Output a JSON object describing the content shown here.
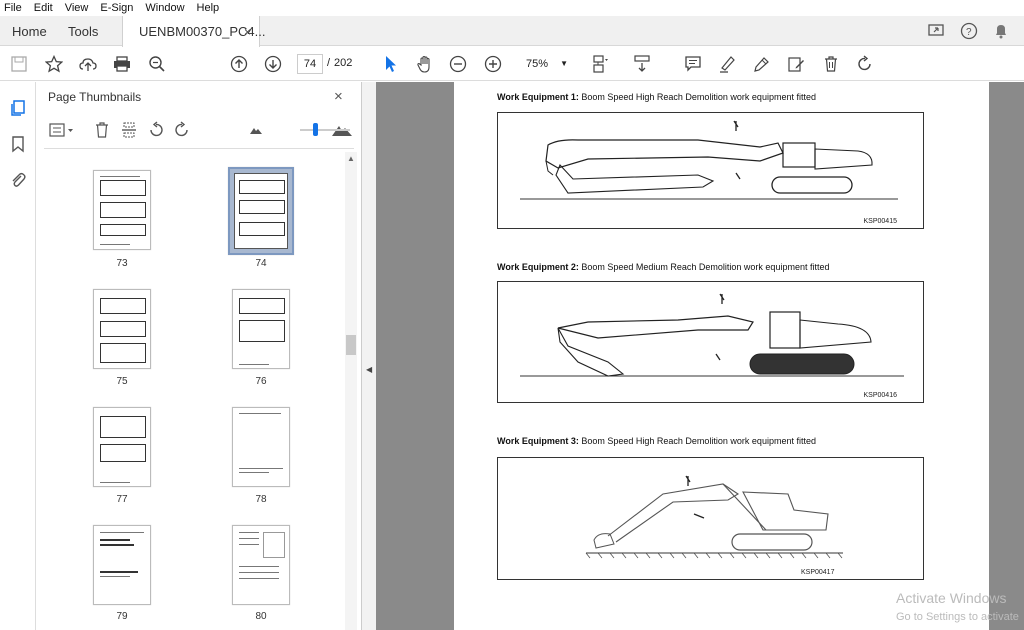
{
  "menu": [
    "File",
    "Edit",
    "View",
    "E-Sign",
    "Window",
    "Help"
  ],
  "tabs": {
    "home": "Home",
    "tools": "Tools",
    "document": "UENBM00370_PC4...",
    "close": "×"
  },
  "toolbar": {
    "current_page": "74",
    "separator": "/",
    "total_pages": "202",
    "zoom": "75%"
  },
  "panel": {
    "title": "Page Thumbnails",
    "close": "×",
    "thumbnails": [
      {
        "label": "73"
      },
      {
        "label": "74",
        "selected": true
      },
      {
        "label": "75"
      },
      {
        "label": "76"
      },
      {
        "label": "77"
      },
      {
        "label": "78"
      },
      {
        "label": "79"
      },
      {
        "label": "80"
      }
    ]
  },
  "document": {
    "sections": [
      {
        "prefix": "Work Equipment 1:",
        "text": " Boom Speed High Reach Demolition work equipment fitted",
        "code": "KSP00415"
      },
      {
        "prefix": "Work Equipment 2:",
        "text": " Boom Speed Medium Reach Demolition work equipment fitted",
        "code": "KSP00416"
      },
      {
        "prefix": "Work Equipment 3:",
        "text": " Boom Speed High Reach Demolition work equipment fitted",
        "code": "KSP00417"
      }
    ]
  },
  "watermark": {
    "line1": "Activate Windows",
    "line2": "Go to Settings to activate"
  }
}
